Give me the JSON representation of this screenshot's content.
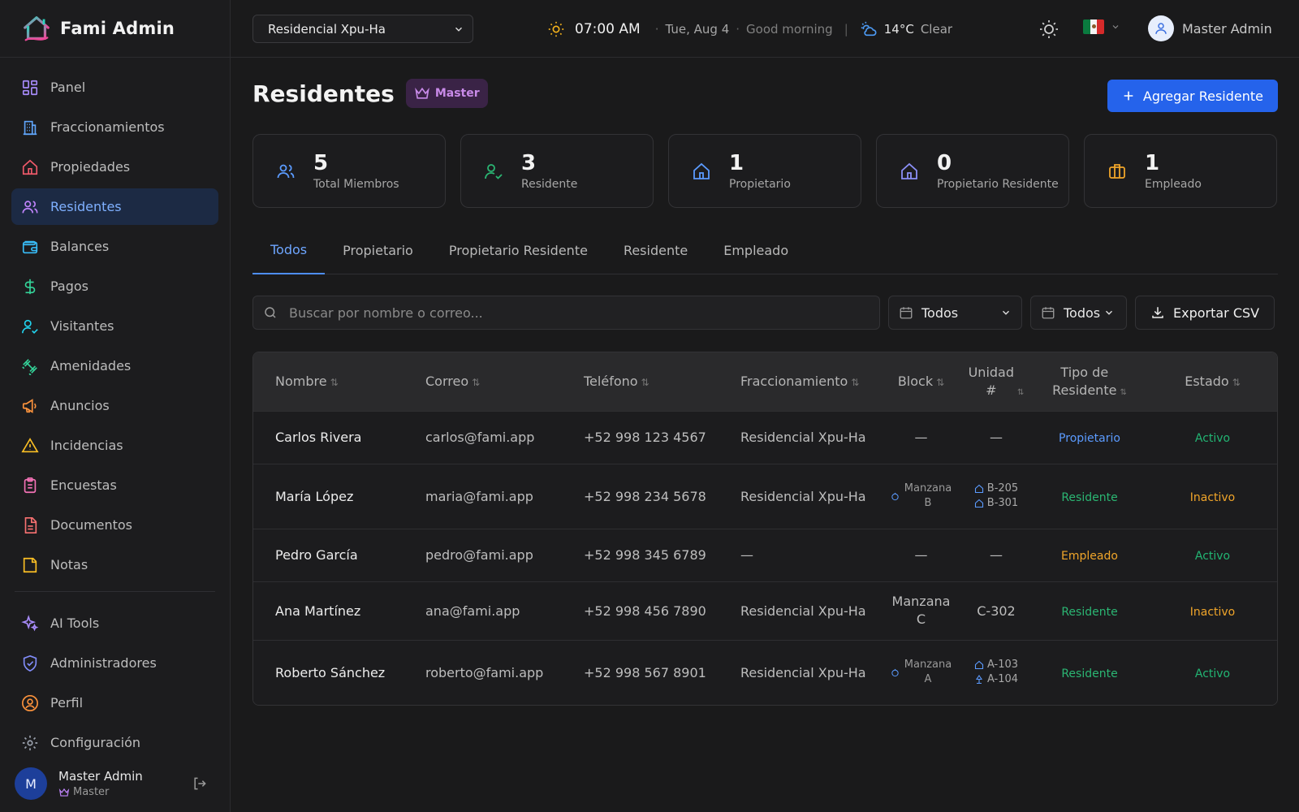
{
  "app": {
    "brand": "Fami Admin"
  },
  "colors": {
    "accent": "#2563eb",
    "active_nav_bg": "#1c2a44",
    "status_active": "#22b573",
    "status_inactive": "#f0a52a"
  },
  "sidebar": {
    "items": [
      {
        "label": "Panel",
        "icon": "grid-icon"
      },
      {
        "label": "Fraccionamientos",
        "icon": "buildings-icon"
      },
      {
        "label": "Propiedades",
        "icon": "home-icon"
      },
      {
        "label": "Residentes",
        "icon": "users-icon",
        "active": true
      },
      {
        "label": "Balances",
        "icon": "wallet-icon"
      },
      {
        "label": "Pagos",
        "icon": "dollar-icon"
      },
      {
        "label": "Visitantes",
        "icon": "user-check-icon"
      },
      {
        "label": "Amenidades",
        "icon": "dumbbell-icon"
      },
      {
        "label": "Anuncios",
        "icon": "megaphone-icon"
      },
      {
        "label": "Incidencias",
        "icon": "warning-icon"
      },
      {
        "label": "Encuestas",
        "icon": "clipboard-icon"
      },
      {
        "label": "Documentos",
        "icon": "document-icon"
      },
      {
        "label": "Notas",
        "icon": "note-icon"
      }
    ],
    "items2": [
      {
        "label": "AI Tools",
        "icon": "sparkles-icon"
      },
      {
        "label": "Administradores",
        "icon": "shield-icon"
      },
      {
        "label": "Perfil",
        "icon": "user-circle-icon"
      },
      {
        "label": "Configuración",
        "icon": "gear-icon"
      }
    ],
    "user": {
      "initial": "M",
      "name": "Master Admin",
      "role": "Master"
    }
  },
  "topbar": {
    "selected_community": "Residencial Xpu-Ha",
    "time": "07:00 AM",
    "date": "Tue, Aug 4",
    "greeting": "Good morning",
    "temperature": "14°C",
    "condition": "Clear",
    "user_name": "Master Admin"
  },
  "page": {
    "title": "Residentes",
    "role_badge": "Master",
    "add_button": "Agregar Residente"
  },
  "stats": [
    {
      "value": "5",
      "label": "Total Miembros"
    },
    {
      "value": "3",
      "label": "Residente"
    },
    {
      "value": "1",
      "label": "Propietario"
    },
    {
      "value": "0",
      "label": "Propietario Residente"
    },
    {
      "value": "1",
      "label": "Empleado"
    }
  ],
  "tabs": [
    "Todos",
    "Propietario",
    "Propietario Residente",
    "Residente",
    "Empleado"
  ],
  "filters": {
    "search_placeholder": "Buscar por nombre o correo...",
    "filter1": "Todos",
    "filter2": "Todos",
    "export": "Exportar CSV"
  },
  "table": {
    "headers": {
      "name": "Nombre",
      "email": "Correo",
      "phone": "Teléfono",
      "community": "Fraccionamiento",
      "block": "Block",
      "unit_1": "Unidad",
      "unit_2": "#",
      "type_1": "Tipo de",
      "type_2": "Residente",
      "status": "Estado"
    },
    "rows": [
      {
        "name": "Carlos Rivera",
        "email": "carlos@fami.app",
        "phone": "+52 998 123 4567",
        "community": "Residencial Xpu-Ha",
        "block": "—",
        "unit": "—",
        "type": "Propietario",
        "status": "Activo"
      },
      {
        "name": "María López",
        "email": "maria@fami.app",
        "phone": "+52 998 234 5678",
        "community": "Residencial Xpu-Ha",
        "block_a": "Manzana",
        "block_b": "B",
        "unit_a": "B-205",
        "unit_b": "B-301",
        "type": "Residente",
        "status": "Inactivo"
      },
      {
        "name": "Pedro García",
        "email": "pedro@fami.app",
        "phone": "+52 998 345 6789",
        "community": "—",
        "block": "—",
        "unit": "—",
        "type": "Empleado",
        "status": "Activo"
      },
      {
        "name": "Ana Martínez",
        "email": "ana@fami.app",
        "phone": "+52 998 456 7890",
        "community": "Residencial Xpu-Ha",
        "block_a": "Manzana",
        "block_b": "C",
        "unit": "C-302",
        "type": "Residente",
        "status": "Inactivo"
      },
      {
        "name": "Roberto Sánchez",
        "email": "roberto@fami.app",
        "phone": "+52 998 567 8901",
        "community": "Residencial Xpu-Ha",
        "block_a": "Manzana",
        "block_b": "A",
        "unit_a": "A-103",
        "unit_b": "A-104",
        "type": "Residente",
        "status": "Activo"
      }
    ]
  }
}
